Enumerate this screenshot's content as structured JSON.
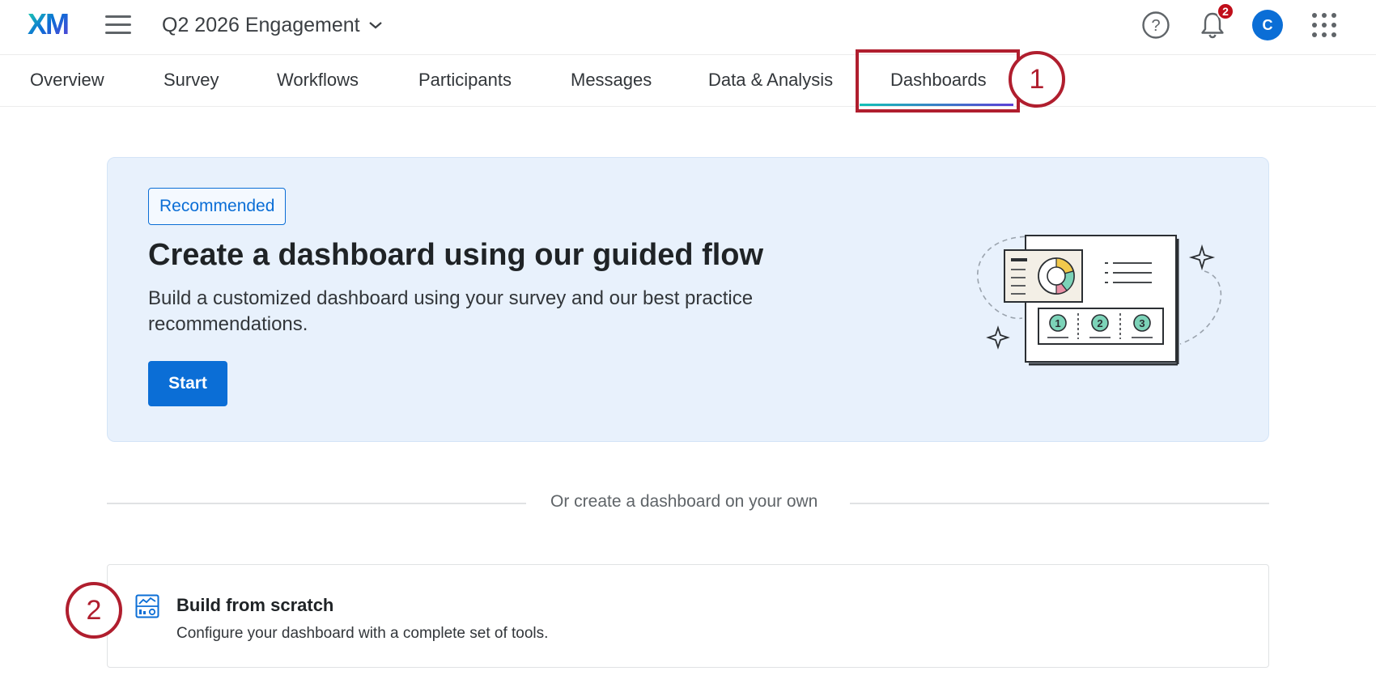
{
  "header": {
    "logo_text": "XM",
    "project_name": "Q2 2026 Engagement",
    "notification_count": "2",
    "avatar_initial": "C",
    "icons": {
      "menu": "hamburger-menu-icon",
      "project_dropdown": "chevron-down-icon",
      "help": "help-circle-icon",
      "notifications": "bell-icon",
      "apps": "app-grid-icon"
    }
  },
  "tabs": {
    "items": [
      {
        "label": "Overview"
      },
      {
        "label": "Survey"
      },
      {
        "label": "Workflows"
      },
      {
        "label": "Participants"
      },
      {
        "label": "Messages"
      },
      {
        "label": "Data & Analysis"
      },
      {
        "label": "Dashboards",
        "active": true
      }
    ]
  },
  "callouts": {
    "one": "1",
    "two": "2"
  },
  "recommended": {
    "tag": "Recommended",
    "title": "Create a dashboard using our guided flow",
    "description": "Build a customized dashboard using your survey and our best practice recommendations.",
    "start_label": "Start",
    "illustration_steps": [
      "1",
      "2",
      "3"
    ]
  },
  "divider": {
    "text": "Or create a dashboard on your own"
  },
  "scratch": {
    "title": "Build from scratch",
    "description": "Configure your dashboard with a complete set of tools.",
    "icon": "dashboard-chart-icon"
  },
  "colors": {
    "accent": "#0b6ed6",
    "annotation": "#b01e2e",
    "card_bg": "#e8f1fc",
    "badge": "#c00e1a"
  }
}
